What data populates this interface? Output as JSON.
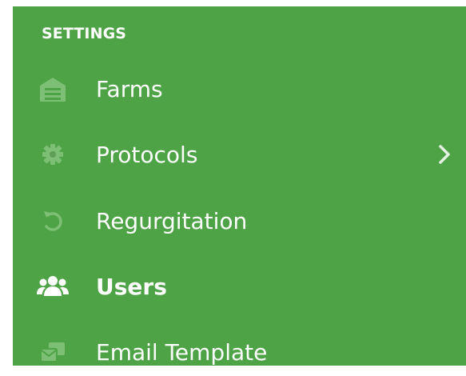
{
  "colors": {
    "sidebar_bg": "#4da345",
    "icon_muted": "#7dbf74",
    "text": "#ffffff"
  },
  "sidebar": {
    "section_title": "SETTINGS",
    "items": [
      {
        "label": "Farms",
        "icon": "warehouse-icon",
        "active": false,
        "has_submenu": false
      },
      {
        "label": "Protocols",
        "icon": "gear-icon",
        "active": false,
        "has_submenu": true
      },
      {
        "label": "Regurgitation",
        "icon": "undo-icon",
        "active": false,
        "has_submenu": false
      },
      {
        "label": "Users",
        "icon": "users-icon",
        "active": true,
        "has_submenu": false
      },
      {
        "label": "Email Template",
        "icon": "email-template-icon",
        "active": false,
        "has_submenu": false
      }
    ]
  }
}
